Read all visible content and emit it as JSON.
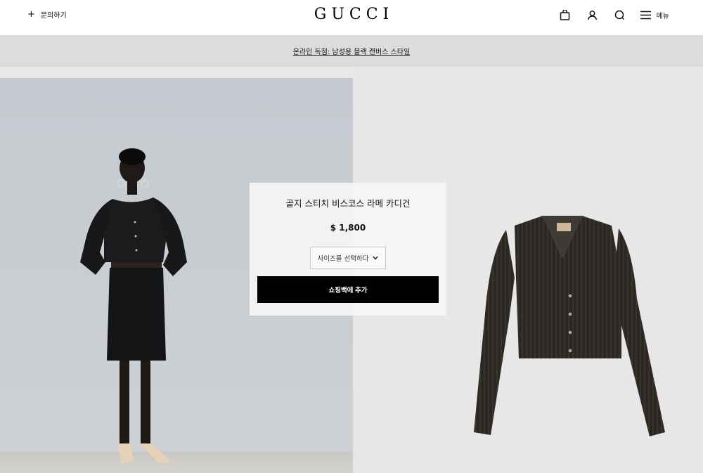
{
  "header": {
    "contact_icon": "+",
    "contact_label": "문의하기",
    "logo": "GUCCI",
    "icons": [
      "shopping-bag-icon",
      "user-icon",
      "search-icon",
      "menu-icon"
    ],
    "menu_label": "메뉴"
  },
  "promo": {
    "text": "온라인 독점: 남성용 블랙 캔버스 스타일"
  },
  "product": {
    "name": "골지 스티치 비스코스 라메 카디건",
    "price": "$ 1,800",
    "size_select_label": "사이즈를 선택하다",
    "add_to_bag_label": "쇼핑백에 추가"
  },
  "colors": {
    "promo_bg": "#dcdcdc",
    "button_bg": "#000000",
    "left_backdrop": "#c6ccd0",
    "right_backdrop": "#e7e7e7"
  }
}
